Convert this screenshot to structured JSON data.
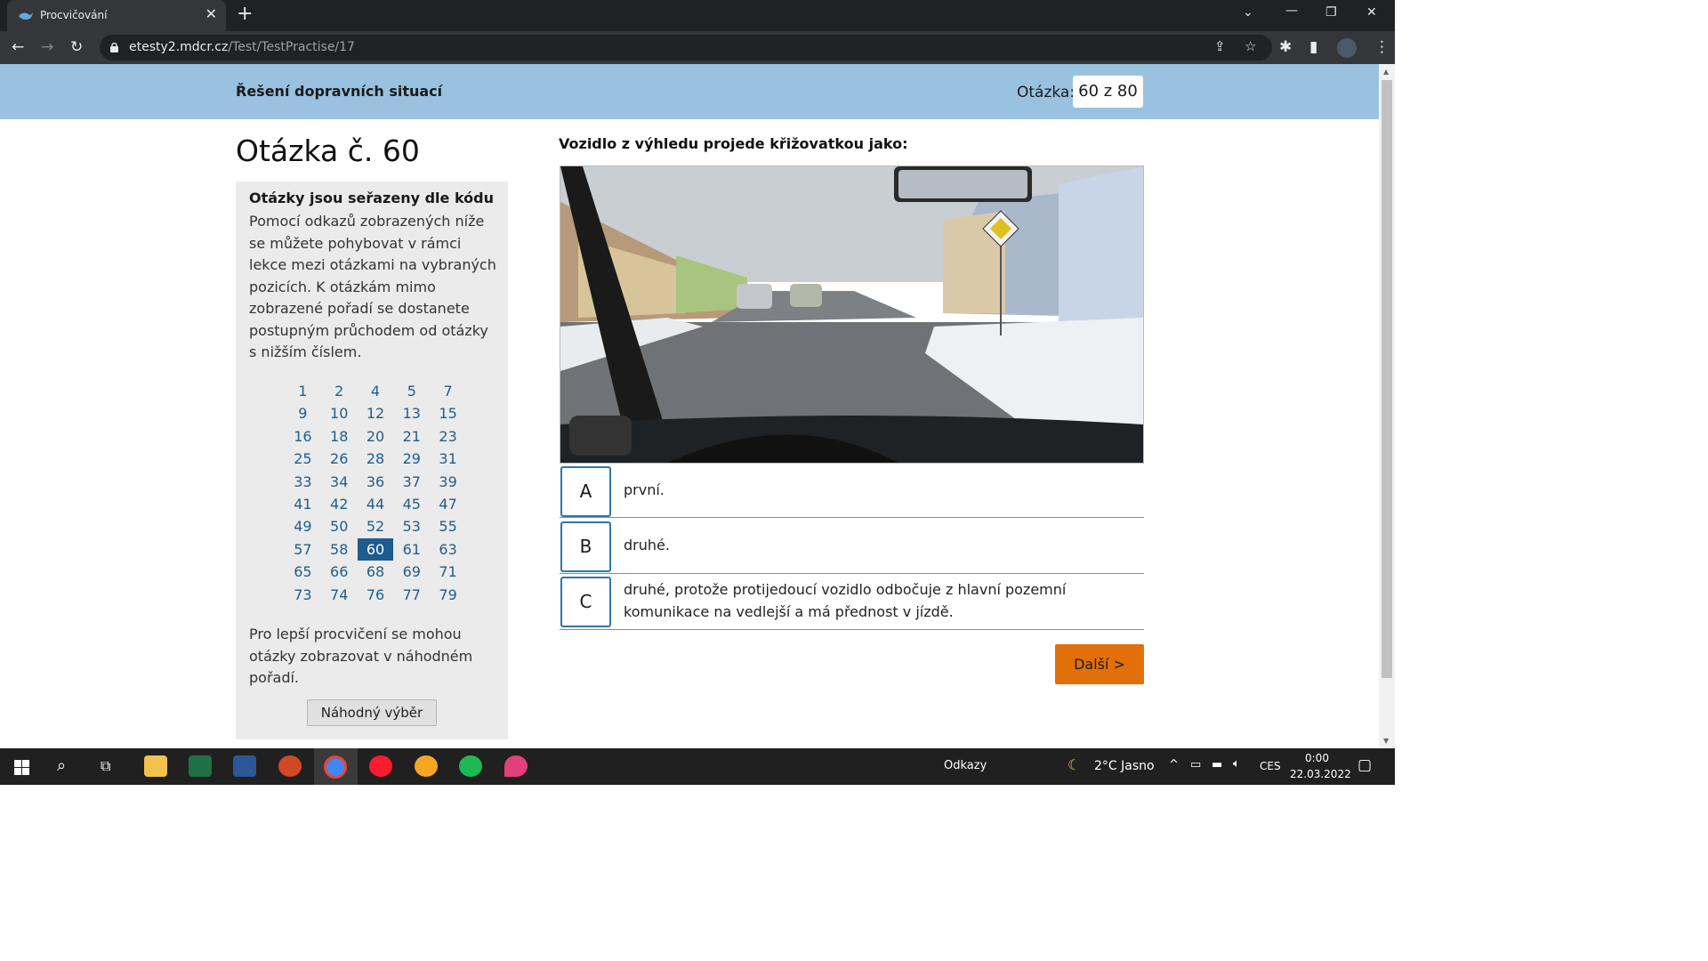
{
  "browser": {
    "tab_title": "Procvičování",
    "url_domain": "etesty2.mdcr.cz",
    "url_path": "/Test/TestPractise/17"
  },
  "header": {
    "section_title": "Řešení dopravních situací",
    "question_label": "Otázka:",
    "question_counter": "60 z 80"
  },
  "heading": "Otázka č. 60",
  "sidebar": {
    "title": "Otázky jsou seřazeny dle kódu",
    "description": "Pomocí odkazů zobrazených níže se můžete pohybovat v rámci lekce mezi otázkami na vybraných pozicích. K otázkám mimo zobrazené pořadí se dostanete postupným průchodem od otázky s nižším číslem.",
    "question_numbers": [
      [
        "1",
        "2",
        "4",
        "5",
        "7"
      ],
      [
        "9",
        "10",
        "12",
        "13",
        "15"
      ],
      [
        "16",
        "18",
        "20",
        "21",
        "23"
      ],
      [
        "25",
        "26",
        "28",
        "29",
        "31"
      ],
      [
        "33",
        "34",
        "36",
        "37",
        "39"
      ],
      [
        "41",
        "42",
        "44",
        "45",
        "47"
      ],
      [
        "49",
        "50",
        "52",
        "53",
        "55"
      ],
      [
        "57",
        "58",
        "60",
        "61",
        "63"
      ],
      [
        "65",
        "66",
        "68",
        "69",
        "71"
      ],
      [
        "73",
        "74",
        "76",
        "77",
        "79"
      ]
    ],
    "active_number": "60",
    "footer_text": "Pro lepší procvičení se mohou otázky zobrazovat v náhodném pořadí.",
    "random_button": "Náhodný výběr"
  },
  "question": {
    "text": "Vozidlo z výhledu projede křižovatkou jako:",
    "answers": [
      {
        "letter": "A",
        "text": "první."
      },
      {
        "letter": "B",
        "text": "druhé."
      },
      {
        "letter": "C",
        "text": "druhé, protože protijedoucí vozidlo odbočuje z hlavní pozemní komunikace na vedlejší a má přednost v jízdě."
      }
    ],
    "next_button": "Další >"
  },
  "taskbar": {
    "links_label": "Odkazy",
    "weather": "2°C  Jasno",
    "language": "CES",
    "time": "0:00",
    "date": "22.03.2022"
  },
  "colors": {
    "header_bg": "#99c2e1",
    "link": "#205e8c",
    "active_cell": "#1f5b8c",
    "answer_border": "#2e77a9",
    "next_button": "#e2700a"
  }
}
